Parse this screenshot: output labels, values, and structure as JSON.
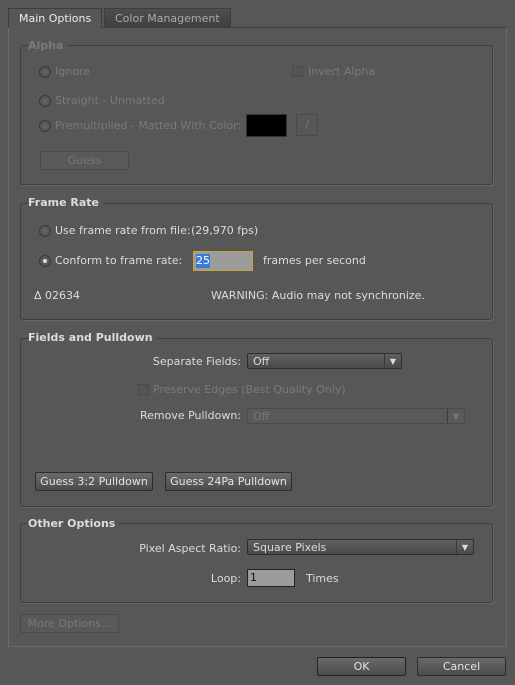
{
  "tabs": {
    "main": "Main Options",
    "color": "Color Management"
  },
  "alpha": {
    "title": "Alpha",
    "ignore": "Ignore",
    "invert": "Invert Alpha",
    "straight": "Straight - Unmatted",
    "premult": "Premultiplied - Matted With Color:",
    "matte_color": "#000000",
    "guess": "Guess"
  },
  "frame_rate": {
    "title": "Frame Rate",
    "use_file": "Use frame rate from file:",
    "file_fps": "(29,970 fps)",
    "conform": "Conform to frame rate:",
    "conform_value": "25",
    "fps_unit": "frames per second",
    "delta": "Δ 02634",
    "warning": "WARNING: Audio may not synchronize.",
    "selected": "conform"
  },
  "fields": {
    "title": "Fields and Pulldown",
    "separate_label": "Separate Fields:",
    "separate_value": "Off",
    "preserve": "Preserve Edges (Best Quality Only)",
    "remove_label": "Remove Pulldown:",
    "remove_value": "Off",
    "guess32": "Guess 3:2 Pulldown",
    "guess24": "Guess 24Pa Pulldown"
  },
  "other": {
    "title": "Other Options",
    "par_label": "Pixel Aspect Ratio:",
    "par_value": "Square Pixels",
    "loop_label": "Loop:",
    "loop_value": "1",
    "times": "Times"
  },
  "footer": {
    "more": "More Options...",
    "ok": "OK",
    "cancel": "Cancel"
  }
}
